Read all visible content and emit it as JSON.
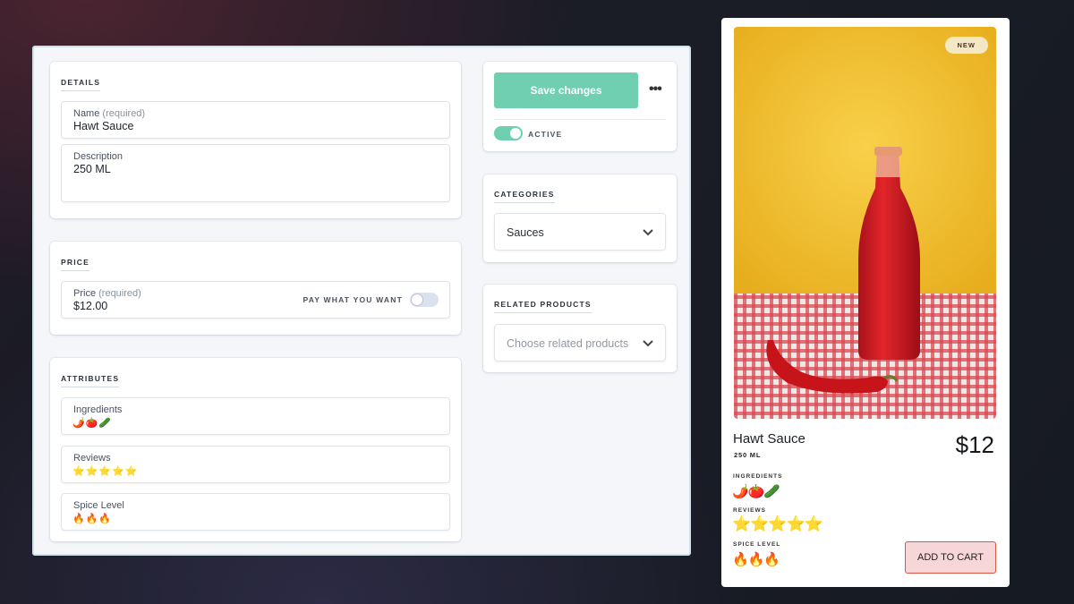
{
  "details": {
    "title": "DETAILS",
    "name_label": "Name",
    "name_required": "(required)",
    "name_value": "Hawt Sauce",
    "description_label": "Description",
    "description_value": "250 ML"
  },
  "price": {
    "title": "PRICE",
    "label": "Price",
    "required": "(required)",
    "value": "$12.00",
    "pwyw_label": "PAY WHAT YOU WANT",
    "pwyw_on": false
  },
  "attributes": {
    "title": "ATTRIBUTES",
    "items": [
      {
        "label": "Ingredients",
        "value": "🌶️🍅🥒"
      },
      {
        "label": "Reviews",
        "value": "⭐⭐⭐⭐⭐"
      },
      {
        "label": "Spice Level",
        "value": "🔥🔥🔥"
      }
    ]
  },
  "actions": {
    "save_label": "Save changes",
    "more_label": "•••",
    "active_label": "ACTIVE",
    "active_on": true
  },
  "categories": {
    "title": "CATEGORIES",
    "selected": "Sauces"
  },
  "related": {
    "title": "RELATED PRODUCTS",
    "placeholder": "Choose related products"
  },
  "preview": {
    "badge": "NEW",
    "name": "Hawt Sauce",
    "description": "250 ML",
    "price": "$12",
    "ingredients_label": "INGREDIENTS",
    "ingredients": "🌶️🍅🥒",
    "reviews_label": "REVIEWS",
    "reviews": "⭐⭐⭐⭐⭐",
    "spice_label": "SPICE LEVEL",
    "spice": "🔥🔥🔥",
    "cart_label": "ADD TO CART"
  },
  "colors": {
    "accent": "#6fcfb0",
    "cart_border": "#d9574a",
    "cart_fill": "#f6d6d6",
    "badge_fill": "#f4e8c4"
  }
}
